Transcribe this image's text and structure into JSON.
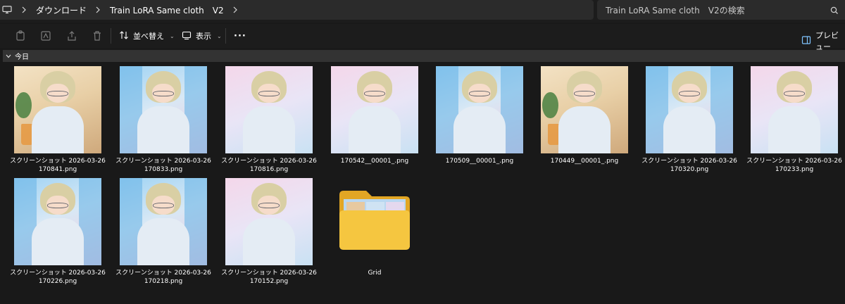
{
  "address": {
    "crumbs": [
      "ダウンロード",
      "Train LoRA Same cloth　V2"
    ]
  },
  "search": {
    "placeholder": "Train LoRA Same cloth　V2の検索"
  },
  "toolbar": {
    "sort_label": "並べ替え",
    "view_label": "表示",
    "more_label": "···",
    "preview_label": "プレビュー"
  },
  "group": {
    "label": "今日"
  },
  "items": [
    {
      "line1": "スクリーンショット 2026-03-26",
      "line2": "170841.png",
      "theme": "cafe"
    },
    {
      "line1": "スクリーンショット 2026-03-26",
      "line2": "170833.png",
      "theme": "city"
    },
    {
      "line1": "スクリーンショット 2026-03-26",
      "line2": "170816.png",
      "theme": "bed"
    },
    {
      "line1": "170542__00001_.png",
      "line2": "",
      "theme": "bed"
    },
    {
      "line1": "170509__00001_.png",
      "line2": "",
      "theme": "city"
    },
    {
      "line1": "170449__00001_.png",
      "line2": "",
      "theme": "cafe"
    },
    {
      "line1": "スクリーンショット 2026-03-26",
      "line2": "170320.png",
      "theme": "city"
    },
    {
      "line1": "スクリーンショット 2026-03-26",
      "line2": "170233.png",
      "theme": "bed"
    },
    {
      "line1": "スクリーンショット 2026-03-26",
      "line2": "170226.png",
      "theme": "city"
    },
    {
      "line1": "スクリーンショット 2026-03-26",
      "line2": "170218.png",
      "theme": "city"
    },
    {
      "line1": "スクリーンショット 2026-03-26",
      "line2": "170152.png",
      "theme": "bed"
    },
    {
      "line1": "Grid",
      "line2": "",
      "theme": "folder"
    }
  ],
  "colors": {
    "background": "#191919",
    "bar": "#2b2b2b",
    "folder_yellow": "#f5c640",
    "folder_back": "#e2a624"
  }
}
